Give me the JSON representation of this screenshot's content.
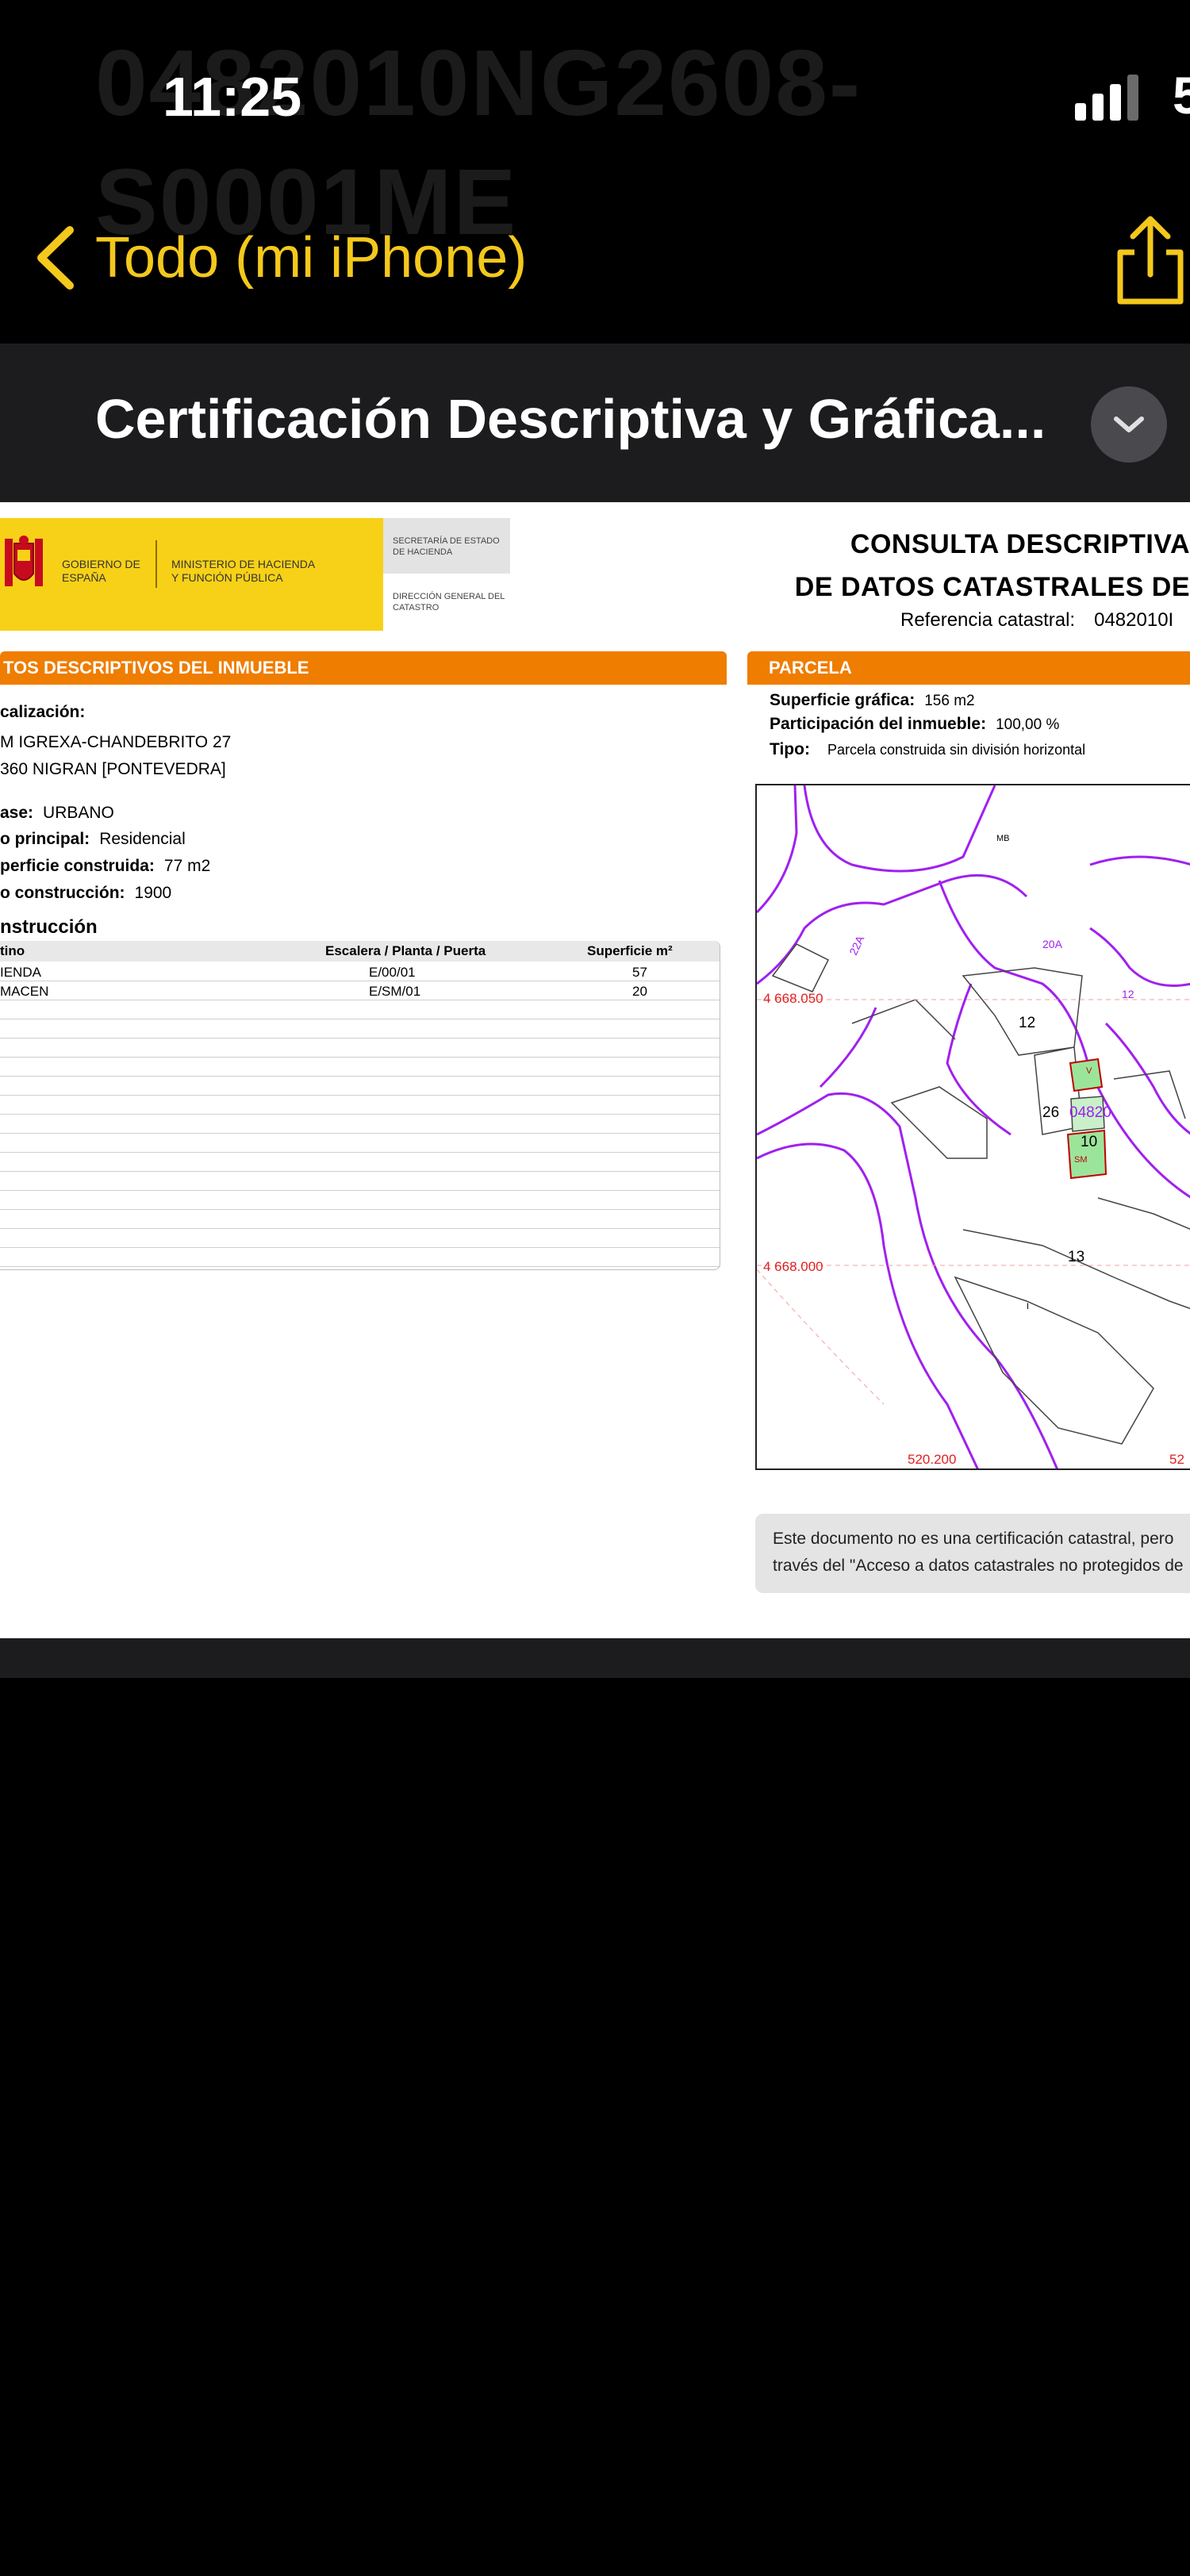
{
  "background_title": "0482010NG2608-S0001ME",
  "status_bar": {
    "time": "11:25",
    "battery": "5"
  },
  "nav": {
    "back_label": "Todo (mi iPhone)"
  },
  "document": {
    "title": "Certificación Descriptiva y Gráfica..."
  },
  "header": {
    "logo_gobierno": "GOBIERNO DE ESPAÑA",
    "logo_ministerio": "MINISTERIO DE HACIENDA Y FUNCIÓN PÚBLICA",
    "secretaria": "SECRETARÍA DE ESTADO DE HACIENDA",
    "direccion": "DIRECCIÓN GENERAL DEL CATASTRO",
    "consulta_line1": "CONSULTA DESCRIPTIVA",
    "consulta_line2": "DE DATOS CATASTRALES DE",
    "ref_label": "Referencia catastral:",
    "ref_value": "0482010I"
  },
  "left_section": {
    "bar_title": "TOS DESCRIPTIVOS DEL INMUEBLE",
    "localizacion_label": "calización:",
    "address_line1": "M IGREXA-CHANDEBRITO 27",
    "address_line2": "360 NIGRAN [PONTEVEDRA]",
    "clase_label": "ase:",
    "clase_value": "URBANO",
    "uso_label": "o principal:",
    "uso_value": "Residencial",
    "superficie_label": "perficie construida:",
    "superficie_value": "77 m2",
    "anio_label": "o construcción:",
    "anio_value": "1900",
    "construccion_label": "nstrucción",
    "table": {
      "headers": [
        "tino",
        "Escalera / Planta / Puerta",
        "Superficie m²"
      ],
      "rows": [
        [
          "IENDA",
          "E/00/01",
          "57"
        ],
        [
          "MACEN",
          "E/SM/01",
          "20"
        ]
      ]
    }
  },
  "right_section": {
    "bar_title": "PARCELA",
    "sup_grafica_label": "Superficie gráfica:",
    "sup_grafica_value": "156 m2",
    "participacion_label": "Participación del inmueble:",
    "participacion_value": "100,00 %",
    "tipo_label": "Tipo:",
    "tipo_value": "Parcela construida sin división horizontal",
    "map_labels": {
      "mb": "MB",
      "n12": "12",
      "n26": "26",
      "parcel": "04820",
      "n10": "10",
      "n13": "13",
      "y_top": "4 668.050",
      "y_bottom": "4 668.000",
      "x_left": "520.200",
      "x_right": "52",
      "road1": "22A",
      "road2": "20A",
      "edge": "12",
      "small_a": "SM",
      "small_b": "I",
      "small_c": "V"
    },
    "note_line1": "Este documento no es una certificación catastral, pero",
    "note_line2": "través del \"Acceso a datos catastrales no protegidos de"
  },
  "colors": {
    "accent_nav": "#f4c81c",
    "orange_bar": "#ef7d00",
    "logo_yellow": "#f7d117",
    "map_lines": "#a020f0"
  }
}
